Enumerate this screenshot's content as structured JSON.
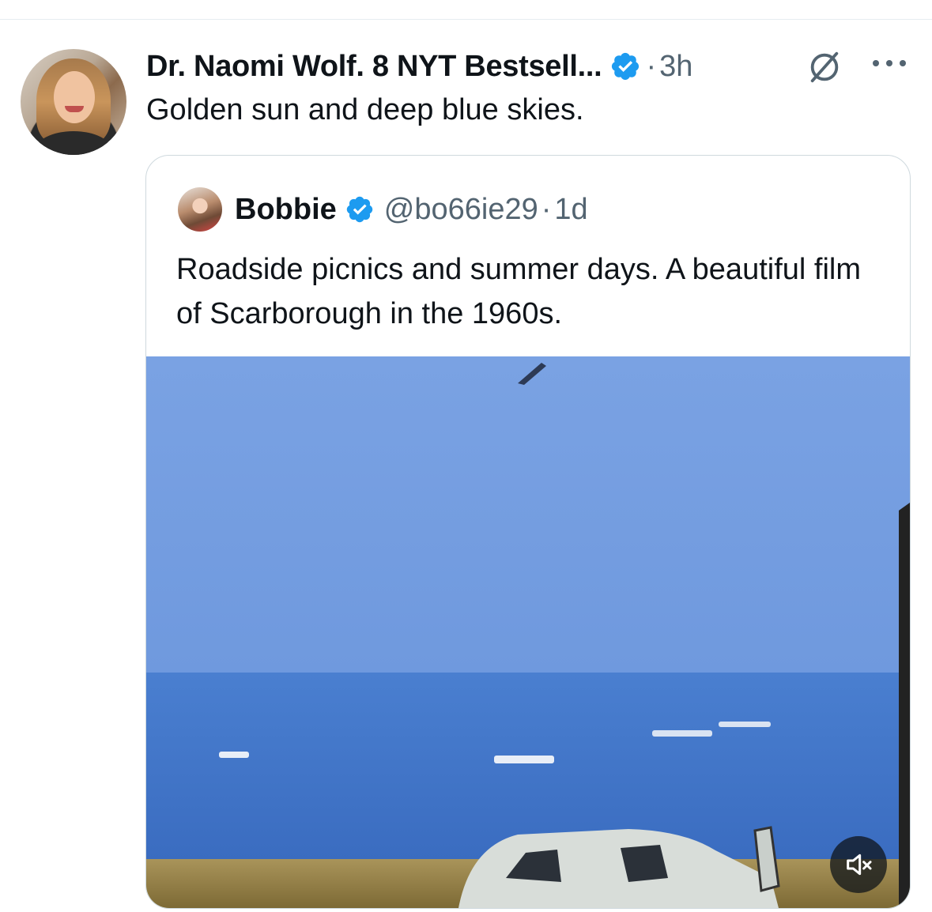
{
  "tweet": {
    "author_name": "Dr. Naomi Wolf. 8 NYT Bestsell...",
    "separator": "·",
    "time": "3h",
    "text": "Golden sun and deep blue skies."
  },
  "quote": {
    "author_name": "Bobbie",
    "handle": "@bo66ie29",
    "separator": "·",
    "time": "1d",
    "text": "Roadside picnics and summer days. A beautiful film of Scarborough in the 1960s."
  },
  "icons": {
    "verified": "verified-badge-icon",
    "grok": "grok-icon",
    "more": "more-icon",
    "mute": "volume-muted-icon"
  },
  "colors": {
    "verified_blue": "#1d9bf0",
    "secondary_text": "#536471",
    "sky": "#7ba3e0",
    "sea": "#3f74c8"
  }
}
